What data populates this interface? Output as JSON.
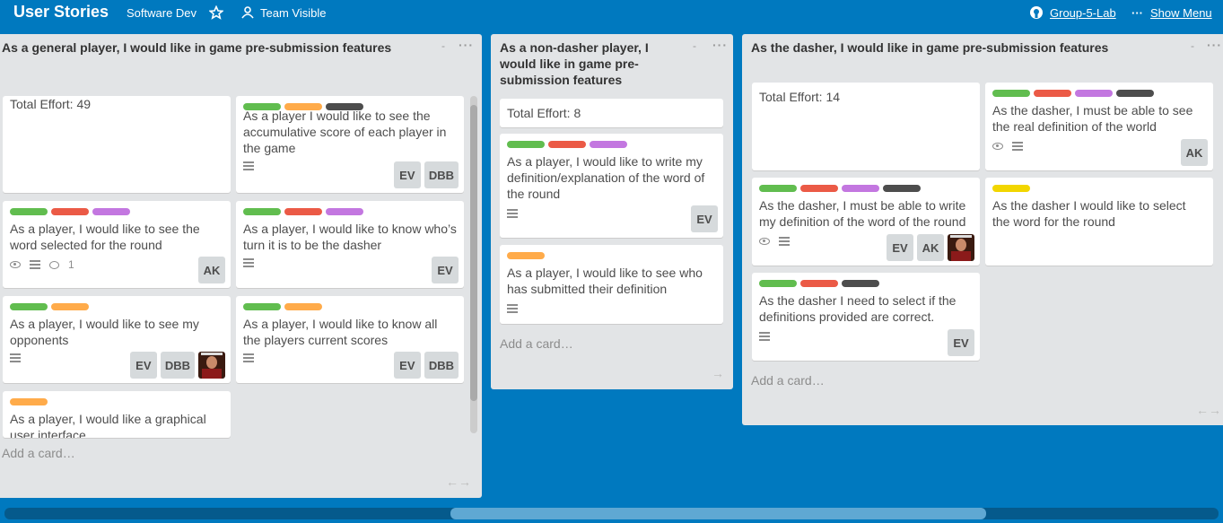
{
  "header": {
    "board_title": "User Stories",
    "team": "Software Dev",
    "visibility": "Team Visible",
    "repo": "Group-5-Lab",
    "menu": "Show Menu"
  },
  "colors": {
    "background": "#0079bf",
    "list": "#e2e4e6",
    "green": "#61bd4f",
    "red": "#eb5a46",
    "purple": "#c377e0",
    "dark": "#4d4d4d",
    "orange": "#ffab4a",
    "yellow": "#f2d600"
  },
  "common": {
    "add_card": "Add a card…",
    "list_dash": "-",
    "list_dots": "···",
    "arrows": "←→",
    "arrow_right": "→"
  },
  "lists": [
    {
      "title": "As a general player, I would like in game pre-submission features",
      "cards": [
        {
          "text": "Total Effort: 49"
        },
        {
          "text": "As a player I would like to see the accumulative score of each player in the game",
          "labels": [
            "green",
            "orange",
            "dark"
          ],
          "members": [
            "EV",
            "DBB"
          ]
        },
        {
          "text": "As a player, I would like to see the word selected for the round",
          "labels": [
            "green",
            "red",
            "purple"
          ],
          "comments": "1",
          "members": [
            "AK"
          ]
        },
        {
          "text": "As a player, I would like to know who’s turn it is to be the dasher",
          "labels": [
            "green",
            "red",
            "purple"
          ],
          "members": [
            "EV"
          ]
        },
        {
          "text": "As a player, I would like to see my opponents",
          "labels": [
            "green",
            "orange"
          ],
          "members": [
            "EV",
            "DBB"
          ]
        },
        {
          "text": "As a player, I would like to know all the players current scores",
          "labels": [
            "green",
            "orange"
          ],
          "members": [
            "EV",
            "DBB"
          ]
        },
        {
          "text": "As a player, I would like a graphical user interface",
          "labels": [
            "orange"
          ]
        }
      ]
    },
    {
      "title": "As a non-dasher player, I would like in game pre-submission features",
      "cards": [
        {
          "text": "Total Effort: 8"
        },
        {
          "text": "As a player, I would like to write my definition/explanation of the word of the round",
          "labels": [
            "green",
            "red",
            "purple"
          ],
          "members": [
            "EV"
          ]
        },
        {
          "text": "As a player, I would like to see who has submitted their definition",
          "labels": [
            "orange"
          ]
        }
      ]
    },
    {
      "title": "As the dasher, I would like in game pre-submission features",
      "cards": [
        {
          "text": "Total Effort: 14"
        },
        {
          "text": "As the dasher, I must be able to see the real definition of the world",
          "labels": [
            "green",
            "red",
            "purple",
            "dark"
          ],
          "members": [
            "AK"
          ]
        },
        {
          "text": "As the dasher, I must be able to write my definition of the word of the round",
          "labels": [
            "green",
            "red",
            "purple",
            "dark"
          ],
          "members": [
            "EV",
            "AK"
          ]
        },
        {
          "text": "As the dasher I would like to select the word for the round",
          "labels": [
            "yellow"
          ]
        },
        {
          "text": "As the dasher I need to select if the definitions provided are correct.",
          "labels": [
            "green",
            "red",
            "dark"
          ],
          "members": [
            "EV"
          ]
        }
      ]
    }
  ]
}
